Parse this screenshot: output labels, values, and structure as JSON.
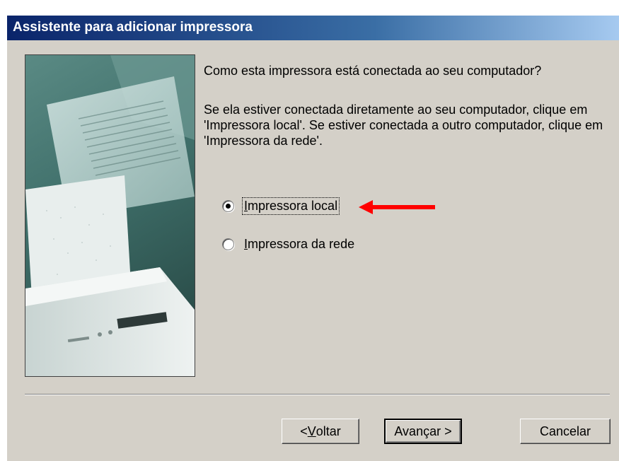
{
  "window": {
    "title": "Assistente para adicionar impressora"
  },
  "content": {
    "question": "Como esta impressora está conectada ao seu computador?",
    "instruction": "Se ela estiver conectada diretamente ao seu computador, clique em 'Impressora local'. Se estiver conectada a outro computador, clique em 'Impressora da rede'."
  },
  "options": {
    "local": {
      "accesskey": "I",
      "rest": "mpressora local",
      "selected": true
    },
    "network": {
      "accesskey": "I",
      "rest": "mpressora da rede",
      "selected": false
    }
  },
  "buttons": {
    "back": {
      "prefix": "< ",
      "accesskey": "V",
      "rest": "oltar"
    },
    "next": {
      "label": "Avançar >"
    },
    "cancel": {
      "label": "Cancelar"
    }
  },
  "annotation": {
    "arrow_color": "#ff0000"
  },
  "colors": {
    "dialog_bg": "#d4d0c8",
    "titlebar_start": "#0a246a",
    "titlebar_end": "#a6caf0"
  }
}
